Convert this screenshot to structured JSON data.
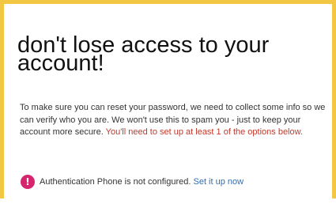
{
  "heading": "don't lose access to your account!",
  "intro": {
    "text": "To make sure you can reset your password, we need to collect some info so we can verify who you are. We won't use this to spam you - just to keep your account more secure. ",
    "warning": "You'll need to set up at least 1 of the options below."
  },
  "auth_phone": {
    "icon": "!",
    "status": "Authentication Phone is not configured.",
    "link": "Set it up now"
  },
  "colors": {
    "frame_border": "#f2c744",
    "warning_text": "#c0392b",
    "link": "#2f6fb6",
    "alert_icon": "#d6246e"
  }
}
